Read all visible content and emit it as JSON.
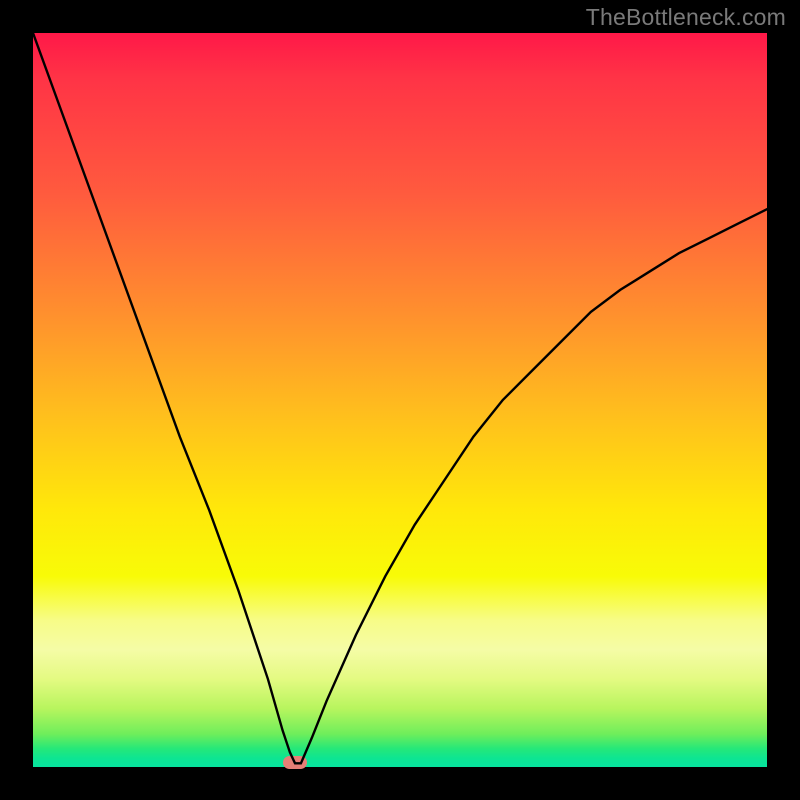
{
  "watermark": "TheBottleneck.com",
  "chart_data": {
    "type": "line",
    "title": "",
    "xlabel": "",
    "ylabel": "",
    "xlim": [
      0,
      100
    ],
    "ylim": [
      0,
      100
    ],
    "grid": false,
    "legend": false,
    "series": [
      {
        "name": "bottleneck-curve",
        "x": [
          0,
          4,
          8,
          12,
          16,
          20,
          24,
          28,
          32,
          34,
          35,
          35.7,
          36.5,
          38,
          40,
          44,
          48,
          52,
          56,
          60,
          64,
          68,
          72,
          76,
          80,
          84,
          88,
          92,
          96,
          100
        ],
        "values": [
          100,
          89,
          78,
          67,
          56,
          45,
          35,
          24,
          12,
          5,
          2,
          0.5,
          0.5,
          4,
          9,
          18,
          26,
          33,
          39,
          45,
          50,
          54,
          58,
          62,
          65,
          67.5,
          70,
          72,
          74,
          76
        ]
      }
    ],
    "marker": {
      "x": 35.7,
      "y": 0.5,
      "shape": "rounded-rect",
      "color": "#e77f76"
    },
    "background_gradient": [
      {
        "stop": 0.0,
        "color": "#ff1848"
      },
      {
        "stop": 0.22,
        "color": "#ff5b3e"
      },
      {
        "stop": 0.52,
        "color": "#ffbf1d"
      },
      {
        "stop": 0.74,
        "color": "#f8fb07"
      },
      {
        "stop": 0.88,
        "color": "#e4fa82"
      },
      {
        "stop": 0.97,
        "color": "#25e879"
      },
      {
        "stop": 1.0,
        "color": "#07e49f"
      }
    ],
    "colors": {
      "curve": "#000000",
      "frame": "#000000",
      "marker": "#e77f76"
    }
  }
}
